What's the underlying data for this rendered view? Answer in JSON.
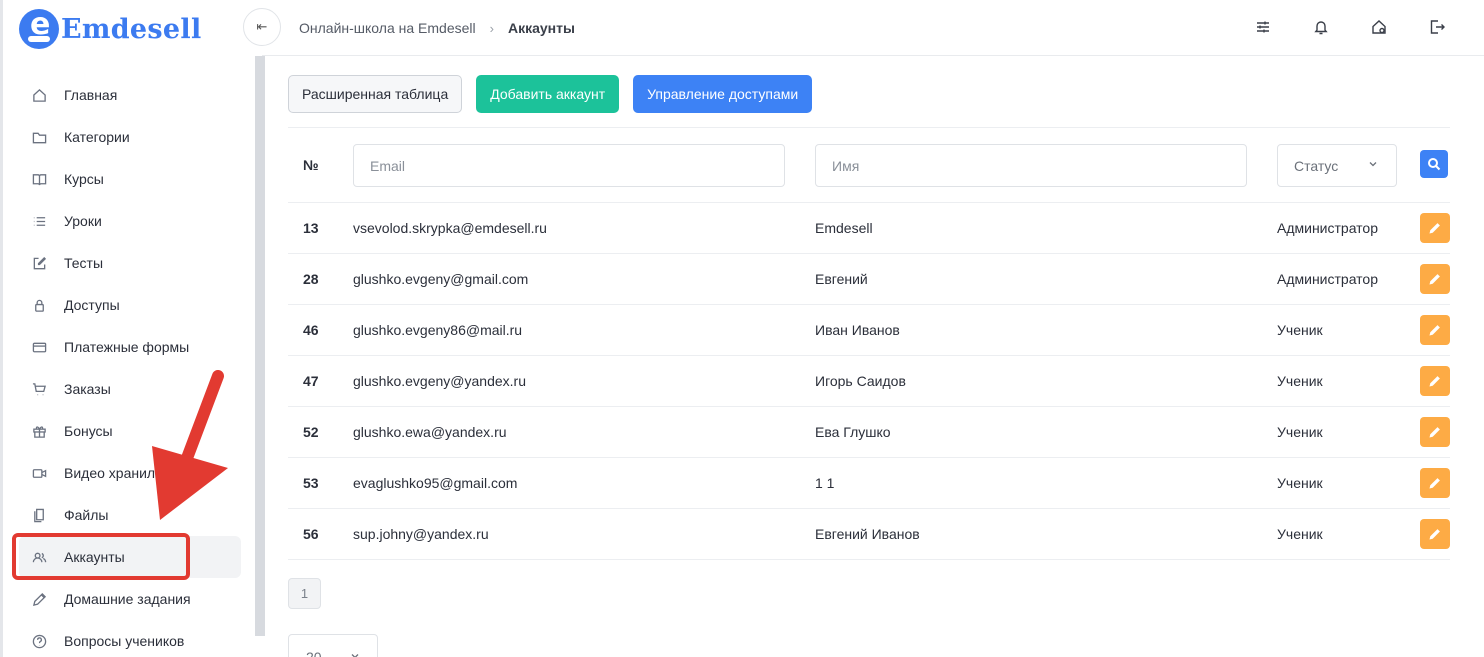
{
  "app": {
    "logo_text": "Emdesell",
    "logo_letter": "e"
  },
  "header": {
    "breadcrumb": [
      "Онлайн-школа на Emdesell",
      "Аккаунты"
    ],
    "collapse_icon": "collapse-left-icon",
    "icons": [
      "sliders-icon",
      "bell-icon",
      "home-settings-icon",
      "logout-icon"
    ]
  },
  "sidebar": {
    "items": [
      {
        "label": "Главная",
        "icon": "home-icon"
      },
      {
        "label": "Категории",
        "icon": "folder-icon"
      },
      {
        "label": "Курсы",
        "icon": "book-icon"
      },
      {
        "label": "Уроки",
        "icon": "list-icon"
      },
      {
        "label": "Тесты",
        "icon": "edit-square-icon"
      },
      {
        "label": "Доступы",
        "icon": "lock-icon"
      },
      {
        "label": "Платежные формы",
        "icon": "credit-card-icon"
      },
      {
        "label": "Заказы",
        "icon": "cart-icon"
      },
      {
        "label": "Бонусы",
        "icon": "gift-icon"
      },
      {
        "label": "Видео хранил",
        "icon": "video-icon"
      },
      {
        "label": "Файлы",
        "icon": "file-icon"
      },
      {
        "label": "Аккаунты",
        "icon": "users-icon",
        "active": true
      },
      {
        "label": "Домашние задания",
        "icon": "pencil-icon"
      },
      {
        "label": "Вопросы учеников",
        "icon": "question-icon"
      }
    ]
  },
  "toolbar": {
    "extended_table": "Расширенная таблица",
    "add_account": "Добавить аккаунт",
    "manage_access": "Управление доступами"
  },
  "filters": {
    "num_header": "№",
    "email_placeholder": "Email",
    "name_placeholder": "Имя",
    "status_label": "Статус"
  },
  "rows": [
    {
      "id": "13",
      "email": "vsevolod.skrypka@emdesell.ru",
      "name": "Emdesell",
      "role": "Администратор"
    },
    {
      "id": "28",
      "email": "glushko.evgeny@gmail.com",
      "name": "Евгений",
      "role": "Администратор"
    },
    {
      "id": "46",
      "email": "glushko.evgeny86@mail.ru",
      "name": "Иван Иванов",
      "role": "Ученик"
    },
    {
      "id": "47",
      "email": "glushko.evgeny@yandex.ru",
      "name": "Игорь Саидов",
      "role": "Ученик"
    },
    {
      "id": "52",
      "email": "glushko.ewa@yandex.ru",
      "name": "Ева Глушко",
      "role": "Ученик"
    },
    {
      "id": "53",
      "email": "evaglushko95@gmail.com",
      "name": "1 1",
      "role": "Ученик"
    },
    {
      "id": "56",
      "email": "sup.johny@yandex.ru",
      "name": "Евгений Иванов",
      "role": "Ученик"
    }
  ],
  "pagination": {
    "current_page": "1",
    "per_page": "20"
  },
  "colors": {
    "brand": "#3c7bf0",
    "green": "#1cc29a",
    "blue": "#3d82f5",
    "edit": "#fdab45",
    "annotation": "#e23a31"
  }
}
